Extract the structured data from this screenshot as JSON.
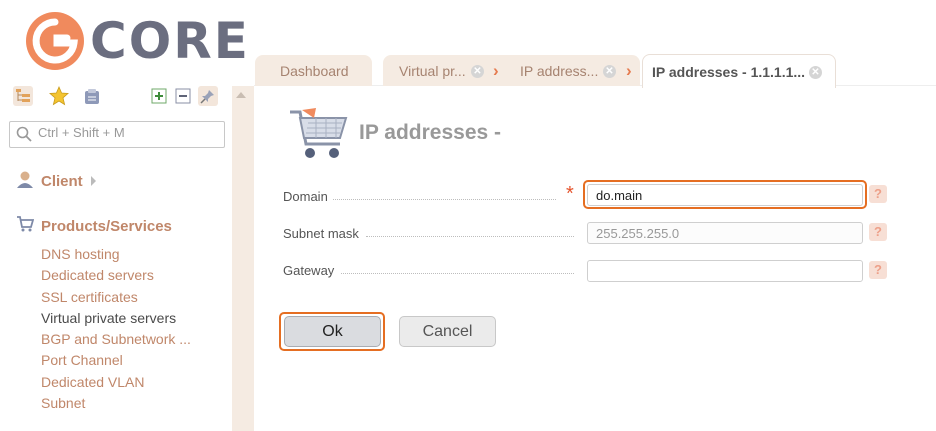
{
  "brand": {
    "name": "CORE",
    "logo_mark": "G",
    "accent": "#F08A5D",
    "primary_text": "#6B6E80"
  },
  "sidebar": {
    "toolbar": [
      "tree-icon",
      "star-icon",
      "clipboard-icon",
      "expand-plus-icon",
      "collapse-minus-icon",
      "pin-icon"
    ],
    "search_placeholder": "Ctrl + Shift + M",
    "groups": [
      {
        "label": "Client",
        "icon": "client-icon",
        "items": []
      },
      {
        "label": "Products/Services",
        "icon": "cart-icon",
        "items": [
          "DNS hosting",
          "Dedicated servers",
          "SSL certificates",
          "Virtual private servers",
          "BGP and Subnetwork ...",
          "Port Channel",
          "Dedicated VLAN",
          "Subnet"
        ],
        "active_item": "Virtual private servers"
      }
    ]
  },
  "tabs": [
    {
      "label": "Dashboard",
      "closable": false
    },
    {
      "label": "Virtual pr...",
      "closable": true
    },
    {
      "label": "IP address...",
      "closable": true
    },
    {
      "label": "IP addresses - 1.1.1.1...",
      "closable": true,
      "active": true
    }
  ],
  "form": {
    "title": "IP addresses -",
    "fields": [
      {
        "label": "Domain",
        "value": "do.main",
        "required": true,
        "highlighted": true
      },
      {
        "label": "Subnet mask",
        "value": "255.255.255.0",
        "disabled": true
      },
      {
        "label": "Gateway",
        "value": ""
      }
    ],
    "help_label": "?",
    "ok_label": "Ok",
    "cancel_label": "Cancel"
  },
  "colors": {
    "link": "#C0876A",
    "highlight": "#E56E22",
    "tab_bg": "#F5EBE2",
    "required": "#E5532C"
  }
}
